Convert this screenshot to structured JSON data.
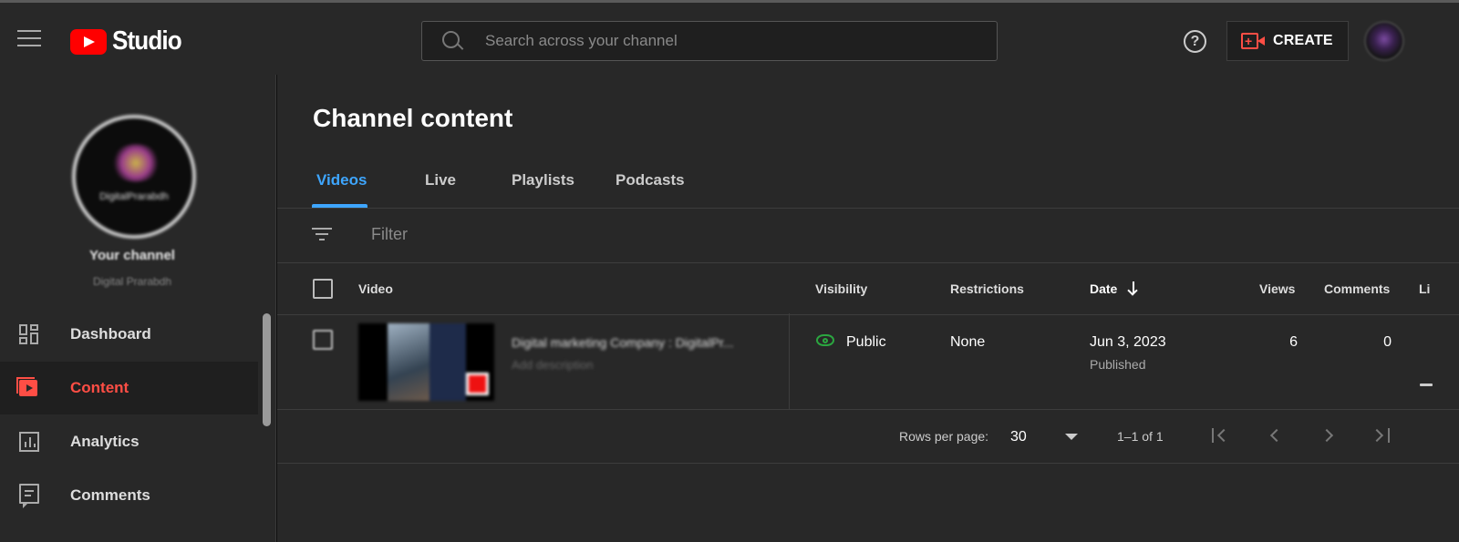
{
  "app": {
    "logo_text": "Studio",
    "search_placeholder": "Search across your channel",
    "help_label": "?",
    "create_label": "CREATE",
    "brand_color": "#ff0000",
    "accent_color": "#3ea6ff"
  },
  "sidebar": {
    "your_channel": "Your channel",
    "channel_name": "Digital Prarabdh",
    "avatar_text": "DigitalPrarabdh",
    "items": [
      {
        "label": "Dashboard",
        "icon": "dashboard-icon",
        "active": false
      },
      {
        "label": "Content",
        "icon": "content-icon",
        "active": true
      },
      {
        "label": "Analytics",
        "icon": "analytics-icon",
        "active": false
      },
      {
        "label": "Comments",
        "icon": "comments-icon",
        "active": false
      }
    ]
  },
  "main": {
    "title": "Channel content",
    "tabs": [
      {
        "label": "Videos",
        "active": true
      },
      {
        "label": "Live",
        "active": false
      },
      {
        "label": "Playlists",
        "active": false
      },
      {
        "label": "Podcasts",
        "active": false
      }
    ],
    "filter_placeholder": "Filter",
    "columns": {
      "video": "Video",
      "visibility": "Visibility",
      "restrictions": "Restrictions",
      "date": "Date",
      "views": "Views",
      "comments": "Comments",
      "likes": "Li"
    },
    "rows": [
      {
        "title": "Digital marketing Company : DigitalPr...",
        "description": "Add description",
        "visibility": "Public",
        "restrictions": "None",
        "date": "Jun 3, 2023",
        "date_status": "Published",
        "views": "6",
        "comments": "0"
      }
    ],
    "pagination": {
      "rows_per_page_label": "Rows per page:",
      "rows_per_page": "30",
      "range": "1–1 of 1"
    }
  }
}
